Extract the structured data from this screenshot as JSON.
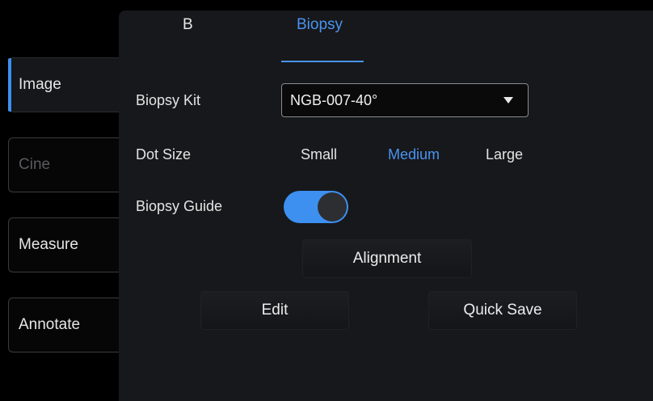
{
  "sidebar": {
    "items": [
      {
        "label": "Image"
      },
      {
        "label": "Cine"
      },
      {
        "label": "Measure"
      },
      {
        "label": "Annotate"
      }
    ]
  },
  "tabs": [
    {
      "label": "B"
    },
    {
      "label": "Biopsy"
    }
  ],
  "biopsy": {
    "kit_label": "Biopsy Kit",
    "kit_value": "NGB-007-40°",
    "dot_size_label": "Dot Size",
    "dot_sizes": [
      {
        "label": "Small"
      },
      {
        "label": "Medium"
      },
      {
        "label": "Large"
      }
    ],
    "dot_size_selected": "Medium",
    "guide_label": "Biopsy Guide",
    "guide_on": true,
    "alignment_label": "Alignment",
    "edit_label": "Edit",
    "quick_save_label": "Quick Save"
  },
  "colors": {
    "accent": "#3d8ff0",
    "panel": "#17181b",
    "background": "#000000"
  }
}
